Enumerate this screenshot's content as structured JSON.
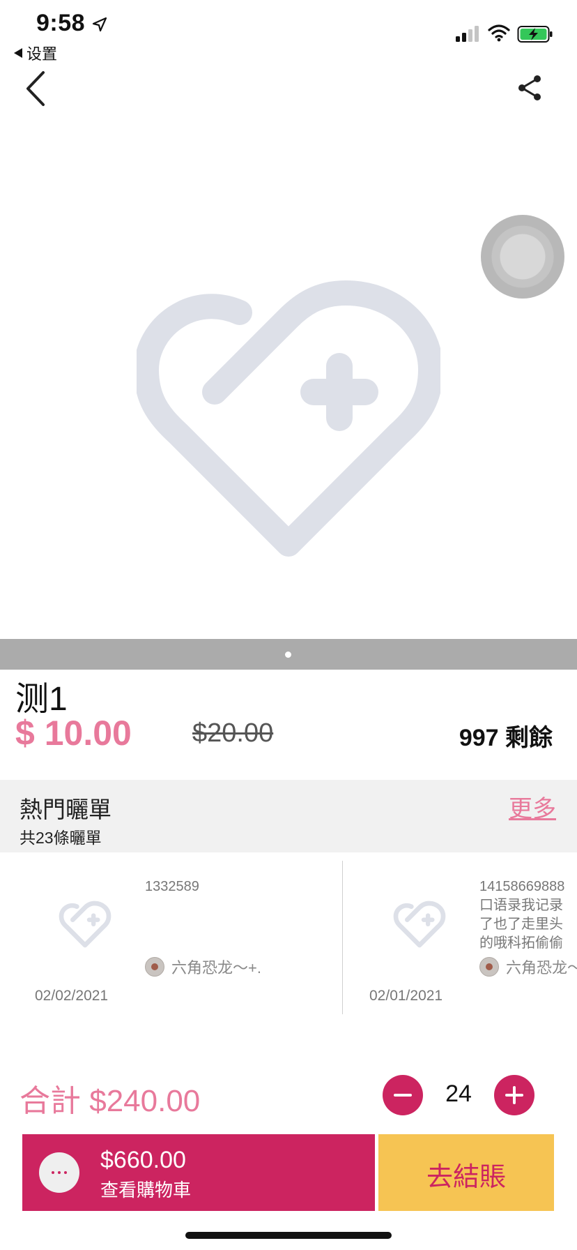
{
  "status_bar": {
    "time": "9:58",
    "back_app_label": "设置"
  },
  "product": {
    "name": "测1",
    "price": "$ 10.00",
    "original_price": "$20.00",
    "stock": "997 剩餘",
    "image_pager": {
      "count": 1,
      "active": 1
    }
  },
  "reviews": {
    "title": "熱門曬單",
    "more_label": "更多",
    "count_label": "共23條曬單",
    "items": [
      {
        "id_text": "1332589",
        "user": "六角恐龙～+.",
        "date": "02/02/2021"
      },
      {
        "text": "14158669888\n口语录我记录\n了也了走里头\n的哦科拓偷偷",
        "user": "六角恐龙～",
        "date": "02/01/2021"
      }
    ]
  },
  "order": {
    "total": "合計 $240.00",
    "quantity": "24"
  },
  "cart": {
    "amount": "$660.00",
    "label": "查看購物車"
  },
  "checkout": {
    "label": "去結賬"
  },
  "colors": {
    "accent_pink": "#e8799b",
    "primary_magenta": "#cc2460",
    "checkout_yellow": "#f6c453",
    "placeholder_grey": "#dde0e8"
  },
  "icons": [
    "location-arrow-icon",
    "signal-icon",
    "wifi-icon",
    "battery-charging-icon",
    "back-chevron-icon",
    "share-icon",
    "heart-plus-placeholder-icon",
    "minus-icon",
    "plus-icon",
    "more-dots-icon"
  ]
}
